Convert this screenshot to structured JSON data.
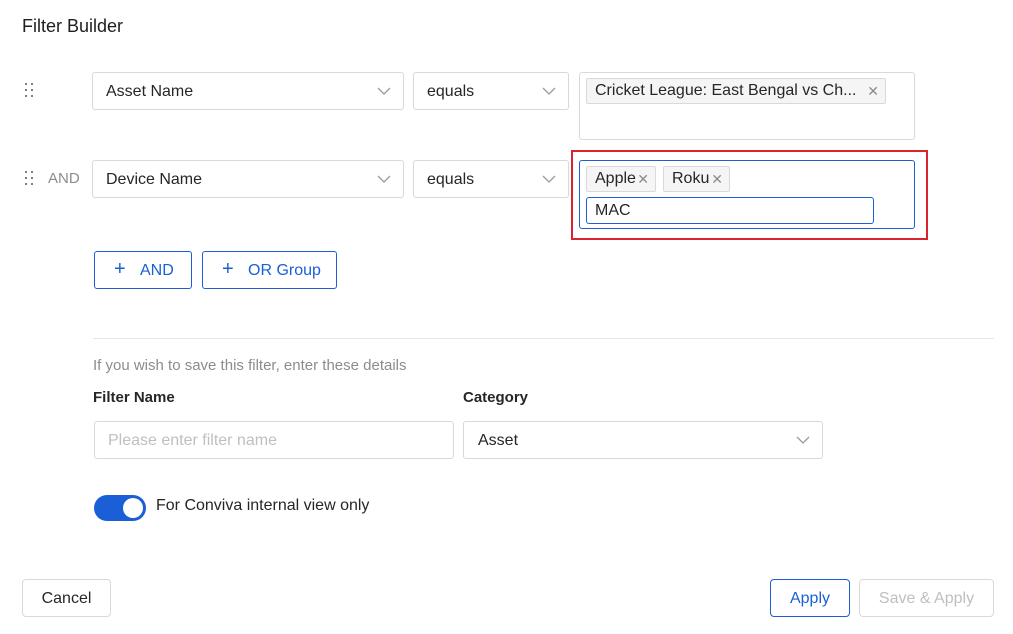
{
  "title": "Filter Builder",
  "rows": [
    {
      "connector": "",
      "field": "Asset Name",
      "operator": "equals",
      "values": [
        "Cricket League: East Bengal vs Ch..."
      ]
    },
    {
      "connector": "AND",
      "field": "Device Name",
      "operator": "equals",
      "values": [
        "Apple",
        "Roku"
      ],
      "typing_value": "MAC"
    }
  ],
  "buttons": {
    "and_label": "AND",
    "or_group_label": "OR Group"
  },
  "save_section": {
    "hint": "If you wish to save this filter, enter these details",
    "filter_name_label": "Filter Name",
    "filter_name_placeholder": "Please enter filter name",
    "category_label": "Category",
    "category_value": "Asset"
  },
  "toggle": {
    "label": "For Conviva internal view only",
    "on": true
  },
  "footer": {
    "cancel": "Cancel",
    "apply": "Apply",
    "save_apply": "Save & Apply"
  },
  "icons": {
    "drag": "drag-handle-icon",
    "chevron": "chevron-down-icon",
    "remove": "close-icon",
    "plus": "plus-icon"
  },
  "colors": {
    "accent": "#1a5fd6",
    "highlight": "#d9232e",
    "muted": "#8c8c8c"
  }
}
